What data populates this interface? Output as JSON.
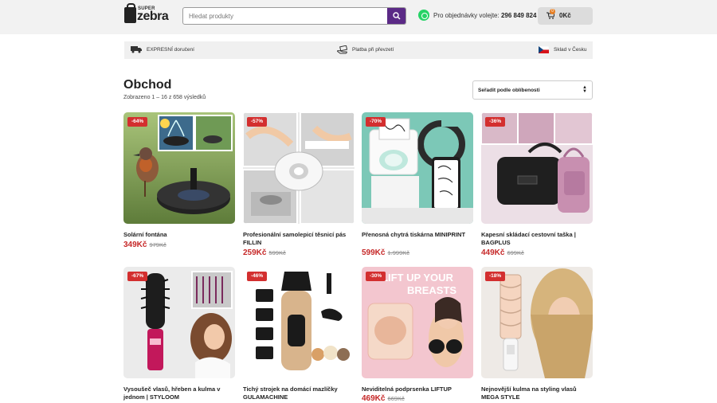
{
  "header": {
    "logo_small": "SUPER",
    "logo_text": "zebra",
    "search_placeholder": "Hledat produkty",
    "phone_label": "Pro objednávky volejte:",
    "phone_number": "296 849 824",
    "cart_total": "0Kč",
    "cart_count": "0"
  },
  "infobar": {
    "delivery": "EXPRESNÍ doručení",
    "payment": "Platba při převzetí",
    "warehouse": "Sklad v Česku"
  },
  "shop": {
    "title": "Obchod",
    "result_count": "Zobrazeno 1 – 16 z 658 výsledků",
    "sort_label": "Seřadit podle oblíbenosti"
  },
  "products": [
    {
      "badge": "-64%",
      "name": "Solární fontána",
      "price": "349Kč",
      "old_price": "979Kč"
    },
    {
      "badge": "-57%",
      "name": "Profesionální samolepicí těsnicí pás FILLIN",
      "price": "259Kč",
      "old_price": "599Kč"
    },
    {
      "badge": "-70%",
      "name": "Přenosná chytrá tiskárna MINIPRINT",
      "price": "599Kč",
      "old_price": "1.999Kč"
    },
    {
      "badge": "-36%",
      "name": "Kapesní skládací cestovní taška | BAGPLUS",
      "price": "449Kč",
      "old_price": "699Kč"
    },
    {
      "badge": "-67%",
      "name": "Vysoušeč vlasů, hřeben a kulma v jednom | STYLOOM",
      "price": "",
      "old_price": ""
    },
    {
      "badge": "-46%",
      "name": "Tichý strojek na domácí mazlíčky GULAMACHINE",
      "price": "",
      "old_price": ""
    },
    {
      "badge": "-30%",
      "name": "Neviditelná podprsenka LIFTUP",
      "price": "469Kč",
      "old_price": "669Kč"
    },
    {
      "badge": "-18%",
      "name": "Nejnovější kulma na styling vlasů MEGA STYLE",
      "price": "",
      "old_price": ""
    }
  ],
  "image_overlay_text": "LIFT UP YOUR BREASTS",
  "colors": {
    "brand_purple": "#5b2a86",
    "discount_red": "#d32f2f",
    "price_red": "#c62828"
  }
}
